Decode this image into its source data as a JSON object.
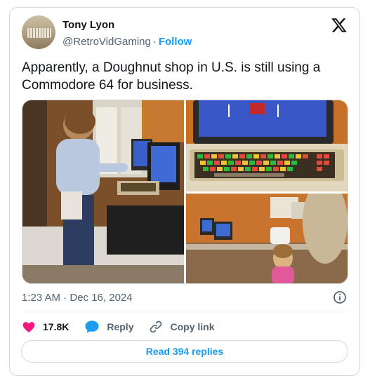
{
  "author": {
    "display_name": "Tony Lyon",
    "handle": "@RetroVidGaming",
    "separator": "·",
    "follow_label": "Follow"
  },
  "tweet": {
    "text": "Apparently, a Doughnut shop in U.S. is still using a Commodore 64 for business.",
    "timestamp": "1:23 AM · Dec 16, 2024"
  },
  "media": {
    "photo_count": 3
  },
  "actions": {
    "like_count": "17.8K",
    "reply_label": "Reply",
    "copy_link_label": "Copy link"
  },
  "replies_button": {
    "label": "Read 394 replies"
  },
  "colors": {
    "accent": "#1d9bf0",
    "like": "#f91880",
    "secondary_text": "#536471",
    "border": "#cfd9de"
  },
  "icons": {
    "logo": "x-logo-icon",
    "info": "info-icon",
    "like": "heart-icon",
    "reply": "reply-bubble-icon",
    "copy_link": "link-icon"
  }
}
